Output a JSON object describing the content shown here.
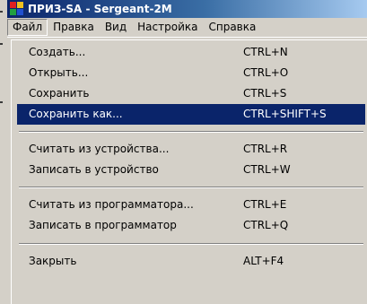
{
  "window": {
    "title": "ПРИЗ-SA - Sergeant-2M",
    "title_bar_color": "#0a246a"
  },
  "menubar": {
    "items": [
      {
        "label": "Файл",
        "active": true
      },
      {
        "label": "Правка"
      },
      {
        "label": "Вид"
      },
      {
        "label": "Настройка"
      },
      {
        "label": "Справка"
      }
    ]
  },
  "file_menu": {
    "selected_color": "#0a246a",
    "items": [
      {
        "label": "Создать...",
        "shortcut": "CTRL+N"
      },
      {
        "label": "Открыть...",
        "shortcut": "CTRL+O"
      },
      {
        "label": "Сохранить",
        "shortcut": "CTRL+S"
      },
      {
        "label": "Сохранить как...",
        "shortcut": "CTRL+SHIFT+S",
        "selected": true
      },
      {
        "label": "Считать из устройства...",
        "shortcut": "CTRL+R"
      },
      {
        "label": "Записать в устройство",
        "shortcut": "CTRL+W"
      },
      {
        "label": "Считать из программатора...",
        "shortcut": "CTRL+E"
      },
      {
        "label": "Записать в программатор",
        "shortcut": "CTRL+Q"
      },
      {
        "label": "Закрыть",
        "shortcut": "ALT+F4"
      }
    ]
  }
}
